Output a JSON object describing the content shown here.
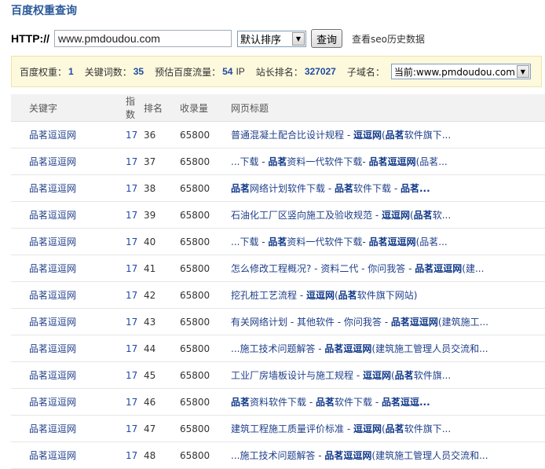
{
  "page": {
    "title": "百度权重查询"
  },
  "query": {
    "prefix": "HTTP://",
    "url_value": "www.pmdoudou.com",
    "sort_selected": "默认排序",
    "submit_label": "查询",
    "history_link": "查看seo历史数据"
  },
  "info": {
    "weight_label": "百度权重：",
    "weight_value": "1",
    "keywords_label": "关键词数：",
    "keywords_value": "35",
    "traffic_label": "预估百度流量：",
    "traffic_value": "54",
    "traffic_unit": "IP",
    "rank_label": "站长排名：",
    "rank_value": "327027",
    "subdomain_label": "子域名：",
    "subdomain_selected": "当前:www.pmdoudou.com"
  },
  "table": {
    "headers": [
      "关键字",
      "指数",
      "排名",
      "收录量",
      "网页标题"
    ],
    "rows": [
      {
        "kw": "品茗逗逗网",
        "idx": "17",
        "rank": "36",
        "inc": "65800",
        "title": [
          [
            "普通混凝土配合比设计规程 - ",
            false
          ],
          [
            "逗逗网",
            true
          ],
          [
            "(",
            false
          ],
          [
            "品茗",
            true
          ],
          [
            "软件旗下...",
            false
          ]
        ]
      },
      {
        "kw": "品茗逗逗网",
        "idx": "17",
        "rank": "37",
        "inc": "65800",
        "title": [
          [
            "...下载 - ",
            false
          ],
          [
            "品茗",
            true
          ],
          [
            "资料一代软件下载- ",
            false
          ],
          [
            "品茗逗逗网",
            true
          ],
          [
            "(品茗...",
            false
          ]
        ]
      },
      {
        "kw": "品茗逗逗网",
        "idx": "17",
        "rank": "38",
        "inc": "65800",
        "title": [
          [
            "品茗",
            true
          ],
          [
            "网络计划软件下载 - ",
            false
          ],
          [
            "品茗",
            true
          ],
          [
            "软件下载 - ",
            false
          ],
          [
            "品茗...",
            true
          ]
        ]
      },
      {
        "kw": "品茗逗逗网",
        "idx": "17",
        "rank": "39",
        "inc": "65800",
        "title": [
          [
            "石油化工厂区竖向施工及验收规范 - ",
            false
          ],
          [
            "逗逗网",
            true
          ],
          [
            "(",
            false
          ],
          [
            "品茗",
            true
          ],
          [
            "软...",
            false
          ]
        ]
      },
      {
        "kw": "品茗逗逗网",
        "idx": "17",
        "rank": "40",
        "inc": "65800",
        "title": [
          [
            "...下载 - ",
            false
          ],
          [
            "品茗",
            true
          ],
          [
            "资料一代软件下载- ",
            false
          ],
          [
            "品茗逗逗网",
            true
          ],
          [
            "(品茗...",
            false
          ]
        ]
      },
      {
        "kw": "品茗逗逗网",
        "idx": "17",
        "rank": "41",
        "inc": "65800",
        "title": [
          [
            "怎么修改工程概况? - 资料二代 - 你问我答 - ",
            false
          ],
          [
            "品茗逗逗网",
            true
          ],
          [
            "(建...",
            false
          ]
        ]
      },
      {
        "kw": "品茗逗逗网",
        "idx": "17",
        "rank": "42",
        "inc": "65800",
        "title": [
          [
            "挖孔桩工艺流程 - ",
            false
          ],
          [
            "逗逗网",
            true
          ],
          [
            "(",
            false
          ],
          [
            "品茗",
            true
          ],
          [
            "软件旗下网站)",
            false
          ]
        ]
      },
      {
        "kw": "品茗逗逗网",
        "idx": "17",
        "rank": "43",
        "inc": "65800",
        "title": [
          [
            "有关网络计划 - 其他软件 - 你问我答 - ",
            false
          ],
          [
            "品茗逗逗网",
            true
          ],
          [
            "(建筑施工...",
            false
          ]
        ]
      },
      {
        "kw": "品茗逗逗网",
        "idx": "17",
        "rank": "44",
        "inc": "65800",
        "title": [
          [
            "...施工技术问题解答 - ",
            false
          ],
          [
            "品茗逗逗网",
            true
          ],
          [
            "(建筑施工管理人员交流和...",
            false
          ]
        ]
      },
      {
        "kw": "品茗逗逗网",
        "idx": "17",
        "rank": "45",
        "inc": "65800",
        "title": [
          [
            "工业厂房墙板设计与施工规程 - ",
            false
          ],
          [
            "逗逗网",
            true
          ],
          [
            "(",
            false
          ],
          [
            "品茗",
            true
          ],
          [
            "软件旗...",
            false
          ]
        ]
      },
      {
        "kw": "品茗逗逗网",
        "idx": "17",
        "rank": "46",
        "inc": "65800",
        "title": [
          [
            "品茗",
            true
          ],
          [
            "资料软件下载 - ",
            false
          ],
          [
            "品茗",
            true
          ],
          [
            "软件下载 - ",
            false
          ],
          [
            "品茗逗逗...",
            true
          ]
        ]
      },
      {
        "kw": "品茗逗逗网",
        "idx": "17",
        "rank": "47",
        "inc": "65800",
        "title": [
          [
            "建筑工程施工质量评价标准 - ",
            false
          ],
          [
            "逗逗网",
            true
          ],
          [
            "(",
            false
          ],
          [
            "品茗",
            true
          ],
          [
            "软件旗下...",
            false
          ]
        ]
      },
      {
        "kw": "品茗逗逗网",
        "idx": "17",
        "rank": "48",
        "inc": "65800",
        "title": [
          [
            "...施工技术问题解答 - ",
            false
          ],
          [
            "品茗逗逗网",
            true
          ],
          [
            "(建筑施工管理人员交流和...",
            false
          ]
        ]
      }
    ]
  }
}
